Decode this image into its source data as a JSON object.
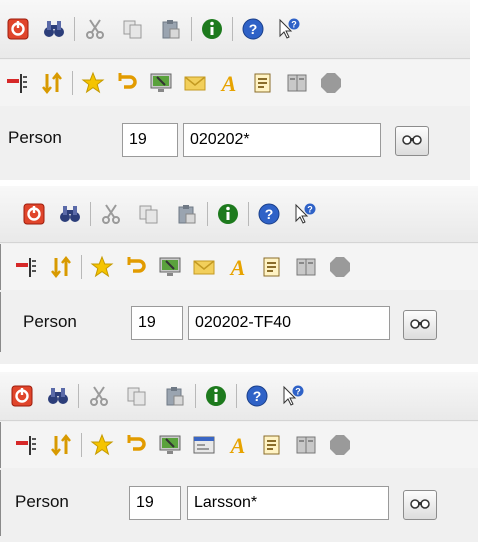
{
  "panels": [
    {
      "toolbar_main": [
        "exit-icon",
        "find-icon",
        "cut-icon",
        "copy-icon",
        "paste-icon",
        "info-icon",
        "help-icon",
        "whats-this-icon"
      ],
      "toolbar_secondary": [
        "red-flag-icon",
        "sort-icon",
        "star-icon",
        "undo-icon",
        "screen-icon",
        "mail-icon",
        "font-icon",
        "notes-icon",
        "book-icon",
        "stop-icon"
      ],
      "field_label": "Person",
      "number_value": "19",
      "search_value": "020202*",
      "search_button_icon": "binoculars-icon"
    },
    {
      "toolbar_main": [
        "exit-icon",
        "find-icon",
        "cut-icon",
        "copy-icon",
        "paste-icon",
        "info-icon",
        "help-icon",
        "whats-this-icon"
      ],
      "toolbar_secondary": [
        "red-flag-icon",
        "sort-icon",
        "star-icon",
        "undo-icon",
        "screen-icon",
        "mail-icon",
        "font-icon",
        "notes-icon",
        "book-icon",
        "stop-icon"
      ],
      "field_label": "Person",
      "number_value": "19",
      "search_value": "020202-TF40",
      "search_button_icon": "binoculars-icon"
    },
    {
      "toolbar_main": [
        "exit-icon",
        "find-icon",
        "cut-icon",
        "copy-icon",
        "paste-icon",
        "info-icon",
        "help-icon",
        "whats-this-icon"
      ],
      "toolbar_secondary": [
        "red-flag-icon",
        "sort-icon",
        "star-icon",
        "undo-icon",
        "screen-icon",
        "window-icon",
        "font-icon",
        "notes-icon",
        "book-icon",
        "stop-icon"
      ],
      "field_label": "Person",
      "number_value": "19",
      "search_value": "Larsson*",
      "search_button_icon": "binoculars-icon"
    }
  ]
}
